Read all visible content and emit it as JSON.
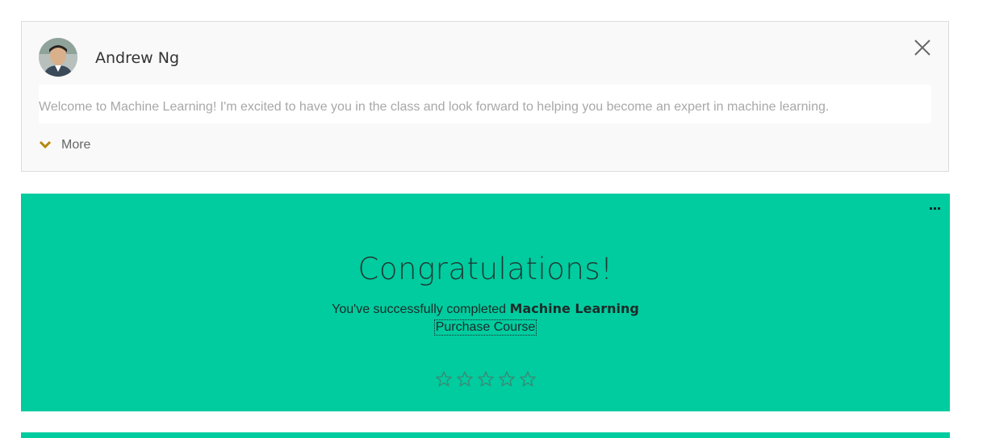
{
  "instructor": {
    "name": "Andrew Ng",
    "message": "Welcome to Machine Learning! I'm excited to have you in the class and look forward to helping you become an expert in machine learning.",
    "more_label": "More",
    "icons": {
      "avatar": "instructor-photo",
      "close": "close-icon",
      "more": "chevron-down-icon"
    }
  },
  "banner": {
    "title": "Congratulations!",
    "subtitle_prefix": "You've successfully completed ",
    "course_name": "Machine Learning",
    "purchase_label": "Purchase Course",
    "rating": {
      "max": 5,
      "value": 0
    },
    "icons": {
      "menu": "more-options-icon",
      "star": "star-outline-icon"
    }
  },
  "colors": {
    "banner_bg": "#00cc9f",
    "card_bg": "#f9f9f9",
    "chevron": "#b8860b",
    "star_outline": "#3a8a76"
  }
}
